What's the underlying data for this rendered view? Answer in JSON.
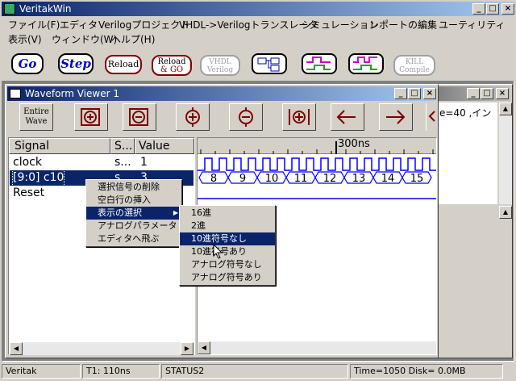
{
  "app": {
    "title": "VeritakWin"
  },
  "menubar": {
    "row1": [
      "ファイル(F)",
      "エディタ",
      "Verilogプロジェクト",
      "VHDL->Verilogトランスレータ",
      "シミュレーション",
      "レポートの編集",
      "ユーティリティ"
    ],
    "row2": [
      "表示(V)",
      "ウィンドウ(W)",
      "ヘルプ(H)"
    ]
  },
  "toolbar": {
    "go": "Go",
    "step": "Step",
    "reload": "Reload",
    "reload_go_1": "Reload",
    "reload_go_2": "& GO",
    "vhdl_1": "VHDL",
    "vhdl_2": "Verilog",
    "kill_1": "KILL",
    "kill_2": "Compile"
  },
  "waveform_viewer": {
    "title": "Waveform Viewer 1",
    "entire_1": "Entire",
    "entire_2": "Wave",
    "time_marker": "300ns",
    "columns": {
      "signal": "Signal",
      "status": "S...",
      "value": "Value"
    },
    "signals": [
      {
        "name": "clock",
        "status": "s...",
        "value": "1"
      },
      {
        "name": "[9:0] c10",
        "status": "s...",
        "value": "3"
      },
      {
        "name": "Reset",
        "status": "",
        "value": ""
      }
    ],
    "bus_values": [
      "8",
      "9",
      "10",
      "11",
      "12",
      "13",
      "14",
      "15"
    ]
  },
  "editor_window": {
    "text": "e=40 ,イン"
  },
  "context_menu": {
    "items": [
      "選択信号の削除",
      "空白行の挿入",
      "表示の選択",
      "アナログパラメータ",
      "エディタへ飛ぶ"
    ],
    "submenu": [
      "16進",
      "2進",
      "10進符号なし",
      "10進符号あり",
      "アナログ符号なし",
      "アナログ符号あり"
    ],
    "selected_item": "表示の選択",
    "selected_submenu": "10進符号なし"
  },
  "statusbar": {
    "app": "Veritak",
    "t1": "T1: 110ns",
    "status": "STATUS2",
    "time_disk": "Time=1050 Disk=  0.0MB"
  },
  "colors": {
    "titlebar": "#0a246a",
    "wave": "#0000ff",
    "highlight": "#0a246a",
    "go_text": "#0000cc",
    "vhdl_disabled": "#a0a0a0",
    "icon_green": "#00aa00",
    "icon_magenta": "#cc00cc"
  }
}
